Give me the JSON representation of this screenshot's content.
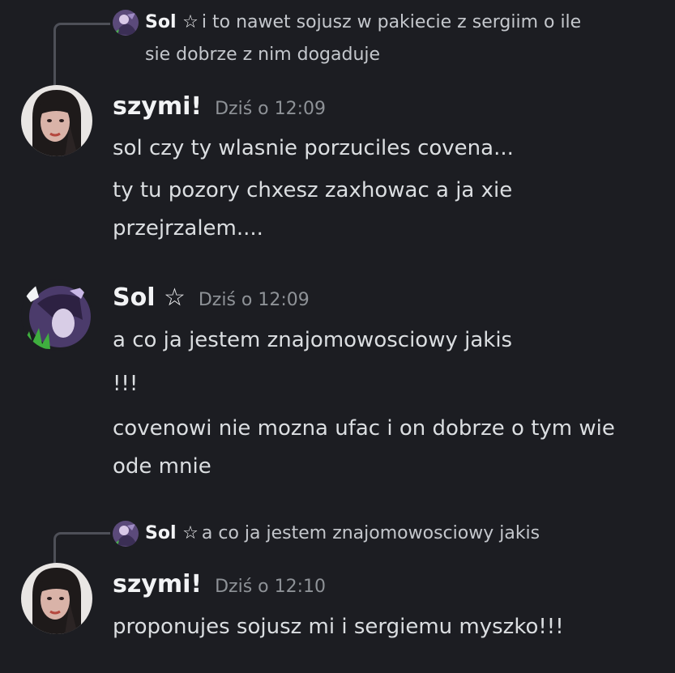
{
  "colors": {
    "background": "#1c1d22",
    "text": "#dbdee1",
    "author": "#f2f3f5",
    "timestamp": "#8e9297",
    "reply_line": "#4e5058"
  },
  "messages": [
    {
      "reply": {
        "author": "Sol ☆",
        "text": "i to nawet sojusz w pakiecie z sergiim o ile",
        "text_cont": "sie dobrze z nim dogaduje",
        "avatar_icon": "sol-avatar-icon"
      },
      "author": "szymi!",
      "timestamp": "Dziś o 12:09",
      "avatar_icon": "szymi-avatar-icon",
      "lines": [
        "sol czy ty wlasnie porzuciles covena...",
        "ty tu pozory chxesz zaxhowac a ja xie",
        "przejrzalem...."
      ]
    },
    {
      "author": "Sol ☆",
      "timestamp": "Dziś o 12:09",
      "avatar_icon": "sol-avatar-icon",
      "lines": [
        "a co ja jestem znajomowosciowy jakis",
        "!!!",
        "covenowi nie mozna ufac i on dobrze o tym wie",
        "ode mnie"
      ]
    },
    {
      "reply": {
        "author": "Sol ☆",
        "text": "a co ja jestem znajomowosciowy jakis",
        "avatar_icon": "sol-avatar-icon"
      },
      "author": "szymi!",
      "timestamp": "Dziś o 12:10",
      "avatar_icon": "szymi-avatar-icon",
      "lines": [
        "proponujes sojusz mi i sergiemu myszko!!!"
      ]
    }
  ]
}
